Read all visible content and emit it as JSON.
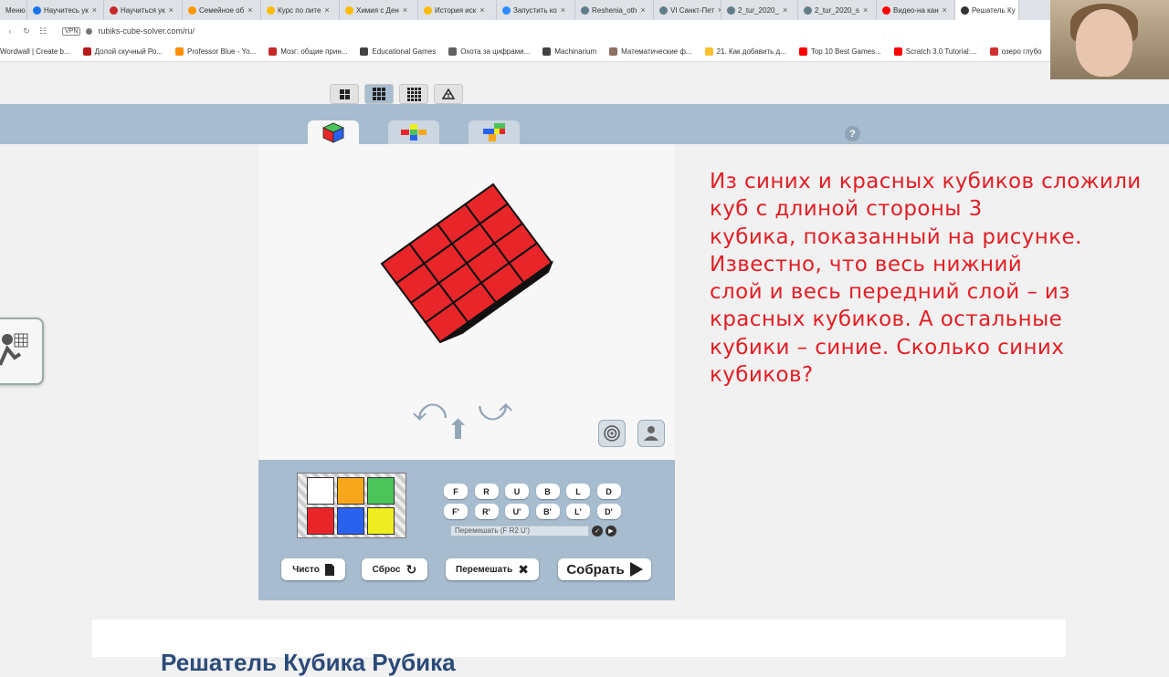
{
  "browser": {
    "tabs": [
      {
        "label": "Меню",
        "color": "#ffffff"
      },
      {
        "label": "Научитесь ук",
        "color": "#1a73e8"
      },
      {
        "label": "Научиться ук",
        "color": "#c62828"
      },
      {
        "label": "Семейное об",
        "color": "#ff9800"
      },
      {
        "label": "Курс по лите",
        "color": "#fbbc04"
      },
      {
        "label": "Химия с Ден",
        "color": "#fbbc04"
      },
      {
        "label": "История иск",
        "color": "#fbbc04"
      },
      {
        "label": "Запустить ко",
        "color": "#2d8cff"
      },
      {
        "label": "Reshenia_oth",
        "color": "#607d8b"
      },
      {
        "label": "VI Санкт-Пет",
        "color": "#607d8b"
      },
      {
        "label": "2_tur_2020_",
        "color": "#607d8b"
      },
      {
        "label": "2_tur_2020_s",
        "color": "#607d8b"
      },
      {
        "label": "Видео-на кан",
        "color": "#ff0000"
      },
      {
        "label": "Решатель Ку",
        "color": "#333333"
      }
    ],
    "url": "rubiks-cube-solver.com/ru/",
    "vpn_label": "VPN",
    "bookmarks": [
      {
        "label": "Wordwall | Create b...",
        "color": "#3f51b5"
      },
      {
        "label": "Долой скучный Ро...",
        "color": "#b71c1c"
      },
      {
        "label": "Professor Blue - Yo...",
        "color": "#ff8f00"
      },
      {
        "label": "Мозг: общие прин...",
        "color": "#c62828"
      },
      {
        "label": "Educational Games",
        "color": "#424242"
      },
      {
        "label": "Охота за цифрами...",
        "color": "#616161"
      },
      {
        "label": "Machinarium",
        "color": "#424242"
      },
      {
        "label": "Математические ф...",
        "color": "#8d6e63"
      },
      {
        "label": "21. Как добавить д...",
        "color": "#fbc02d"
      },
      {
        "label": "Top 10 Best Games...",
        "color": "#ff0000"
      },
      {
        "label": "Scratch 3.0 Tutorial:...",
        "color": "#ff0000"
      },
      {
        "label": "озеро глубо",
        "color": "#d32f2f"
      }
    ]
  },
  "moves": {
    "row1": [
      "F",
      "R",
      "U",
      "B",
      "L",
      "D"
    ],
    "row2": [
      "F'",
      "R'",
      "U'",
      "B'",
      "L'",
      "D'"
    ]
  },
  "scramble_field": "Перемешать (F R2 U')",
  "actions": {
    "clear": "Чисто",
    "reset": "Сброс",
    "scramble": "Перемешать",
    "solve": "Собрать"
  },
  "palette": [
    "#ffffff",
    "#f7a71b",
    "#4cc45a",
    "#e8262a",
    "#2a62f0",
    "#f0ee23"
  ],
  "help_label": "?",
  "problem_text": "Из синих и красных кубиков сложили\nкуб с длиной стороны 3\nкубика, показанный на рисунке.\nИзвестно, что весь нижний\nслой и весь передний слой – из\nкрасных кубиков. А остальные\nкубики – синие. Сколько синих\nкубиков?",
  "footer_heading": "Решатель Кубика Рубика",
  "colors": {
    "red": "#e8262a",
    "blue": "#2a62f0",
    "problem_text": "#e31e24"
  }
}
